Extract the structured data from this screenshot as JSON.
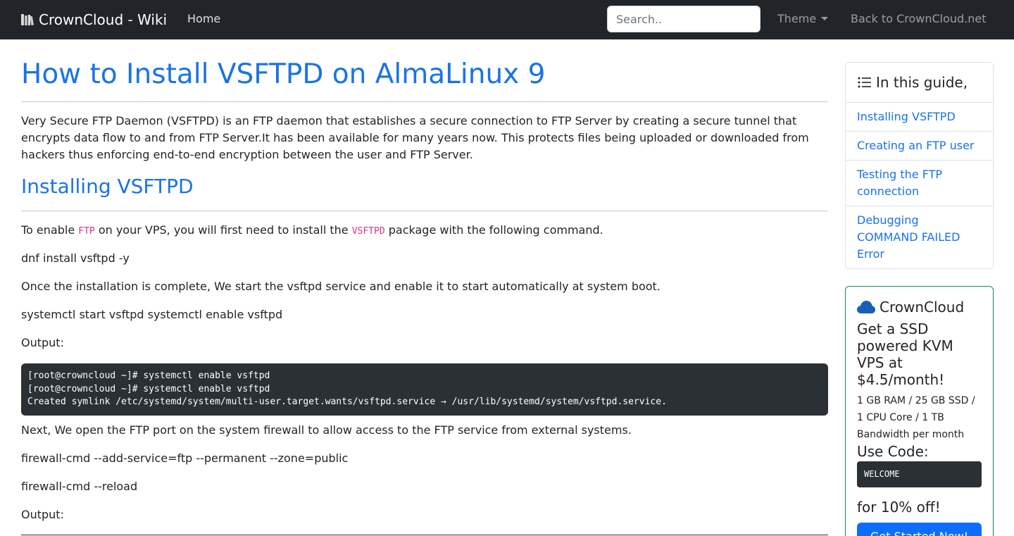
{
  "navbar": {
    "brand": "CrownCloud - Wiki",
    "home": "Home",
    "search_placeholder": "Search..",
    "theme": "Theme",
    "back": "Back to CrownCloud.net"
  },
  "article": {
    "title": "How to Install VSFTPD on AlmaLinux 9",
    "intro": "Very Secure FTP Daemon (VSFTPD) is an FTP daemon that establishes a secure connection to FTP Server by creating a secure tunnel that encrypts data flow to and from FTP Server.It has been available for many years now. This protects files being uploaded or downloaded from hackers thus enforcing end-to-end encryption between the user and FTP Server.",
    "section_heading": "Installing VSFTPD",
    "enable_text_1": "To enable ",
    "enable_code_1": "FTP",
    "enable_text_2": " on your VPS, you will first need to install the ",
    "enable_code_2": "VSFTPD",
    "enable_text_3": " package with the following command.",
    "install_cmd": "dnf install vsftpd -y",
    "after_install": "Once the installation is complete, We start the vsftpd service and enable it to start automatically at system boot.",
    "start_cmd": "systemctl start vsftpd systemctl enable vsftpd",
    "output_label_1": "Output:",
    "terminal_lines": [
      "[root@crowncloud ~]# systemctl enable vsftpd",
      "[root@crowncloud ~]# systemctl enable vsftpd",
      "Created symlink /etc/systemd/system/multi-user.target.wants/vsftpd.service → /usr/lib/systemd/system/vsftpd.service."
    ],
    "firewall_intro": "Next, We open the FTP port on the system firewall to allow access to the FTP service from external systems.",
    "firewall_cmd_1": "firewall-cmd --add-service=ftp --permanent --zone=public",
    "firewall_cmd_2": "firewall-cmd --reload",
    "output_label_2": "Output:"
  },
  "toc": {
    "title": "In this guide,",
    "items": [
      "Installing VSFTPD",
      "Creating an FTP user",
      "Testing the FTP connection",
      "Debugging COMMAND FAILED Error"
    ]
  },
  "promo": {
    "brand": "CrownCloud",
    "headline": "Get a SSD powered KVM VPS at $4.5/month!",
    "specs": "1 GB RAM / 25 GB SSD / 1 CPU Core / 1 TB Bandwidth per month",
    "code_label": "Use Code:",
    "code": "WELCOME",
    "discount": "for 10% off!",
    "cta": "Get Started Now!"
  },
  "colors": {
    "navbar_bg": "#212529",
    "link": "#1a73e8",
    "code_pink": "#d63384",
    "terminal_bg": "#2b3035",
    "promo_border": "#198754",
    "button": "#0d6efd"
  }
}
